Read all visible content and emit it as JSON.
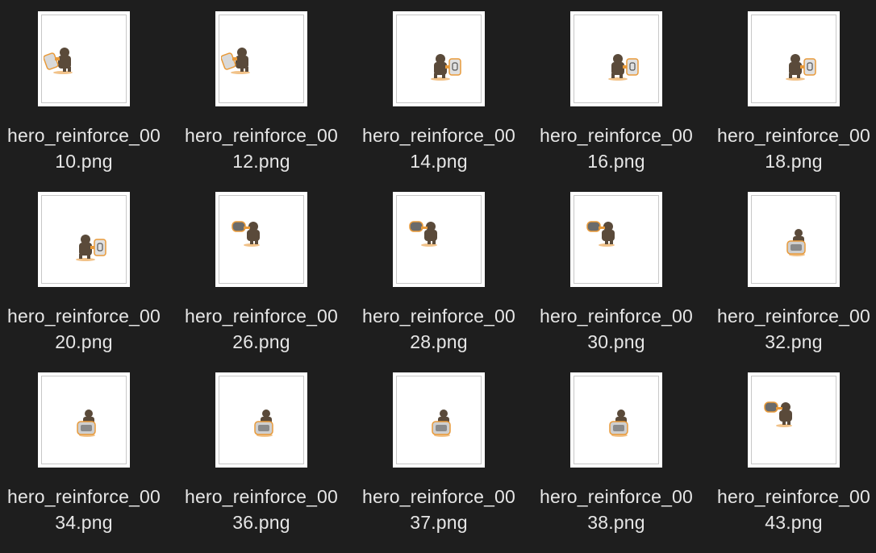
{
  "files": [
    {
      "line1": "hero_reinforce_00",
      "line2": "10.png",
      "pose": "shield-left"
    },
    {
      "line1": "hero_reinforce_00",
      "line2": "12.png",
      "pose": "shield-left"
    },
    {
      "line1": "hero_reinforce_00",
      "line2": "14.png",
      "pose": "shield-right"
    },
    {
      "line1": "hero_reinforce_00",
      "line2": "16.png",
      "pose": "shield-right"
    },
    {
      "line1": "hero_reinforce_00",
      "line2": "18.png",
      "pose": "shield-right"
    },
    {
      "line1": "hero_reinforce_00",
      "line2": "20.png",
      "pose": "shield-right"
    },
    {
      "line1": "hero_reinforce_00",
      "line2": "26.png",
      "pose": "hammer-left"
    },
    {
      "line1": "hero_reinforce_00",
      "line2": "28.png",
      "pose": "hammer-left"
    },
    {
      "line1": "hero_reinforce_00",
      "line2": "30.png",
      "pose": "hammer-left"
    },
    {
      "line1": "hero_reinforce_00",
      "line2": "32.png",
      "pose": "shield-front"
    },
    {
      "line1": "hero_reinforce_00",
      "line2": "34.png",
      "pose": "shield-front"
    },
    {
      "line1": "hero_reinforce_00",
      "line2": "36.png",
      "pose": "shield-front"
    },
    {
      "line1": "hero_reinforce_00",
      "line2": "37.png",
      "pose": "shield-front"
    },
    {
      "line1": "hero_reinforce_00",
      "line2": "38.png",
      "pose": "shield-front"
    },
    {
      "line1": "hero_reinforce_00",
      "line2": "43.png",
      "pose": "hammer-left"
    }
  ],
  "colors": {
    "background": "#1e1e1e",
    "label": "#e6e6e6",
    "thumb": "#ffffff",
    "armor": "#5a4a3a",
    "accent": "#e89a3a"
  }
}
